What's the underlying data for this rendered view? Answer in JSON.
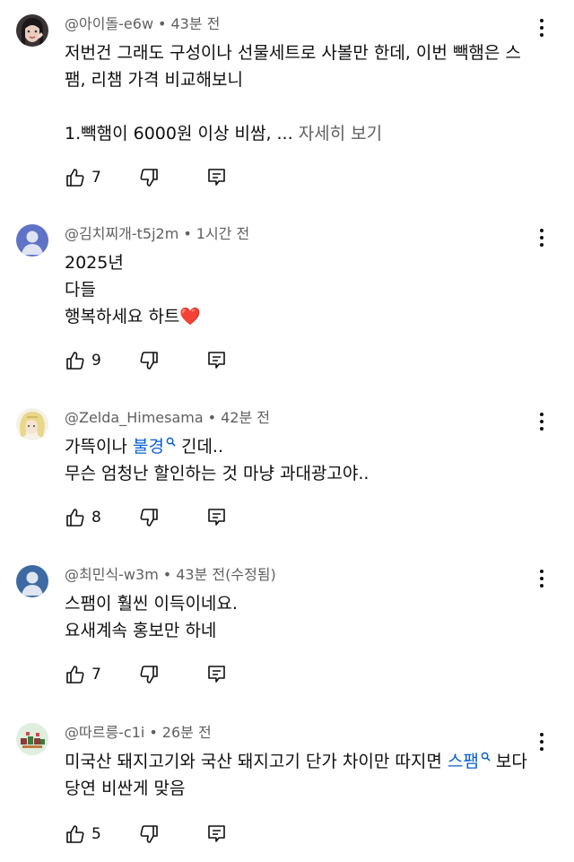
{
  "comments": [
    {
      "author": "@아이돌-e6w",
      "time": "43분 전",
      "lines": [
        "저번건 그래도 구성이나 선물세트로 사볼만 한데, 이번 빽햄은 스",
        "팸, 리챔 가격 비교해보니",
        "",
        "1.빽햄이 6000원 이상 비쌈, ..."
      ],
      "more_label": "자세히 보기",
      "likes": "7",
      "avatar": "photo-avatar"
    },
    {
      "author": "@김치찌개-t5j2m",
      "time": "1시간 전",
      "lines": [
        "2025년",
        "다들",
        "행복하세요 하트❤️"
      ],
      "likes": "9",
      "avatar": "default-avatar"
    },
    {
      "author": "@Zelda_Himesama",
      "time": "42분 전",
      "line1_prefix": "가뜩이나 ",
      "line1_link": "불경",
      "line1_suffix": " 긴데..",
      "line2": "무슨 엄청난 할인하는 것 마냥 과대광고야..",
      "likes": "8",
      "avatar": "anime-avatar"
    },
    {
      "author": "@최민식-w3m",
      "time": "43분 전(수정됨)",
      "lines": [
        "스팸이 훨씬 이득이네요.",
        "요새계속 홍보만 하네"
      ],
      "likes": "7",
      "avatar": "default-avatar"
    },
    {
      "author": "@따르릉-c1i",
      "time": "26분 전",
      "line1_prefix": "미국산 돼지고기와 국산 돼지고기 단가 차이만 따지면 ",
      "line1_link": "스팸",
      "line1_suffix": " 보다",
      "line2": "당연 비싼게 맞음",
      "likes": "5",
      "avatar": "pixel-avatar"
    }
  ],
  "colors": {
    "text": "#0f0f0f",
    "secondary": "#606060",
    "link": "#065fd4",
    "default_avatar_bg": "#5f73c6"
  }
}
